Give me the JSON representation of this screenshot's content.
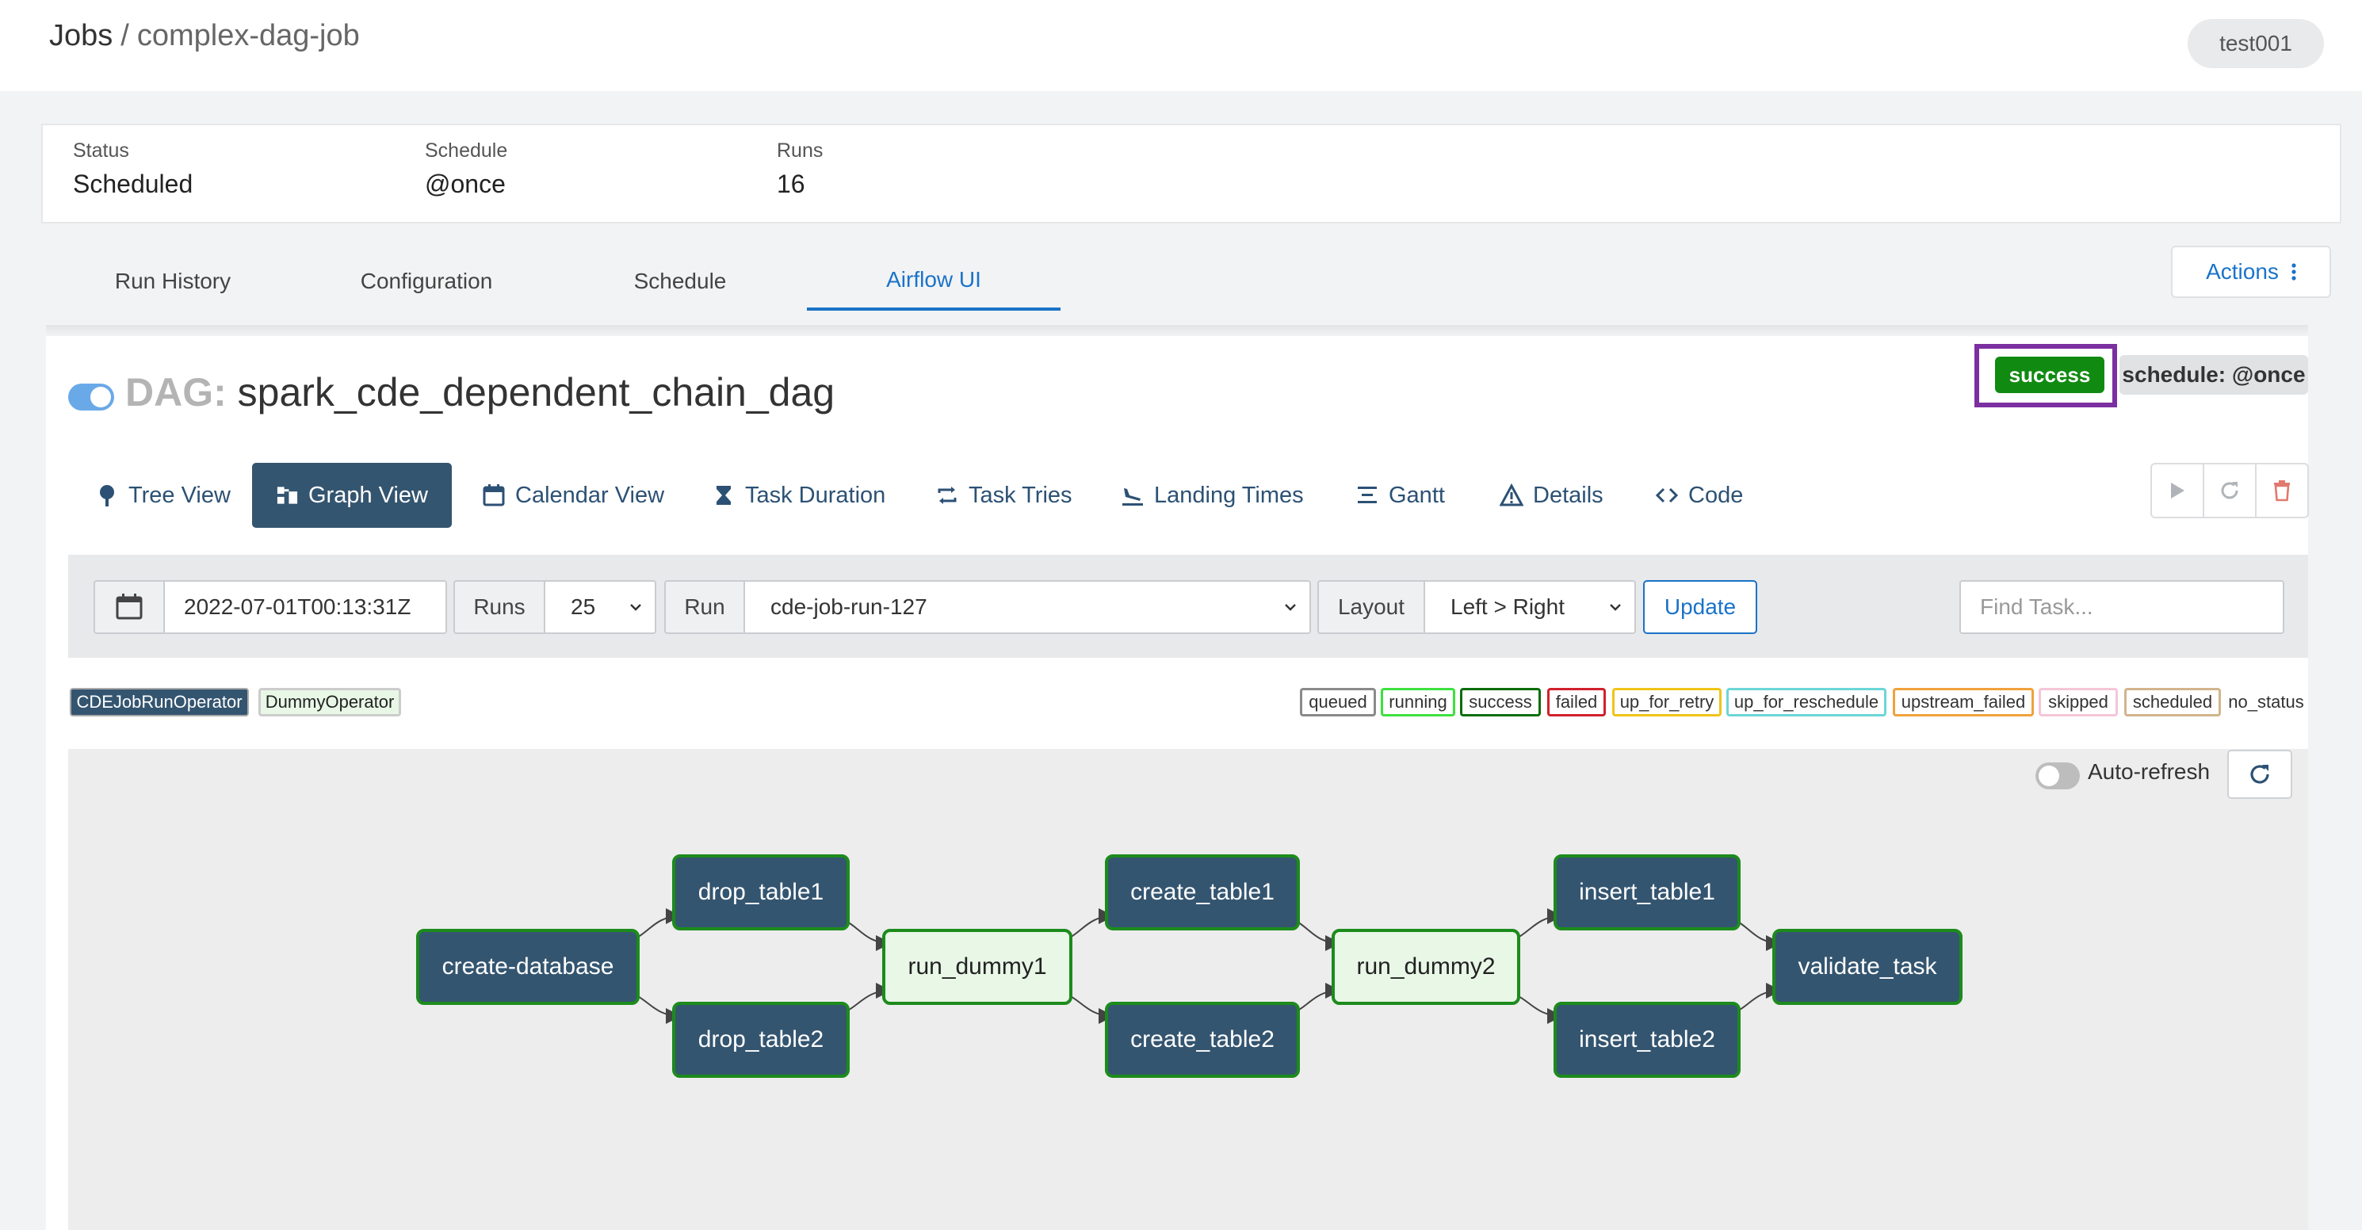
{
  "header": {
    "breadcrumb_root": "Jobs",
    "breadcrumb_sep": "/",
    "job_name": "complex-dag-job",
    "user": "test001"
  },
  "info": {
    "status_label": "Status",
    "status_value": "Scheduled",
    "schedule_label": "Schedule",
    "schedule_value": "@once",
    "runs_label": "Runs",
    "runs_value": "16"
  },
  "tabs": [
    "Run History",
    "Configuration",
    "Schedule",
    "Airflow UI"
  ],
  "active_tab": "Airflow UI",
  "actions_label": "Actions",
  "dag": {
    "prefix": "DAG:",
    "name": "spark_cde_dependent_chain_dag",
    "status": "success",
    "schedule": "schedule: @once"
  },
  "views": [
    "Tree View",
    "Graph View",
    "Calendar View",
    "Task Duration",
    "Task Tries",
    "Landing Times",
    "Gantt",
    "Details",
    "Code"
  ],
  "active_view": "Graph View",
  "filters": {
    "date": "2022-07-01T00:13:31Z",
    "runs_label": "Runs",
    "runs_value": "25",
    "run_label": "Run",
    "run_value": "cde-job-run-127",
    "layout_label": "Layout",
    "layout_value": "Left > Right",
    "update_label": "Update",
    "find_placeholder": "Find Task..."
  },
  "operators": [
    "CDEJobRunOperator",
    "DummyOperator"
  ],
  "states": [
    "queued",
    "running",
    "success",
    "failed",
    "up_for_retry",
    "up_for_reschedule",
    "upstream_failed",
    "skipped",
    "scheduled",
    "no_status"
  ],
  "colors": {
    "accent": "#1a73c8",
    "cde_node": "#345570",
    "dummy_node": "#e8f7e6",
    "success": "#118a11",
    "highlight": "#7b2fa0"
  },
  "graph": {
    "auto_refresh_label": "Auto-refresh",
    "auto_refresh_on": false,
    "nodes": [
      {
        "id": "create-database",
        "op": "cde"
      },
      {
        "id": "drop_table1",
        "op": "cde"
      },
      {
        "id": "drop_table2",
        "op": "cde"
      },
      {
        "id": "run_dummy1",
        "op": "dummy"
      },
      {
        "id": "create_table1",
        "op": "cde"
      },
      {
        "id": "create_table2",
        "op": "cde"
      },
      {
        "id": "run_dummy2",
        "op": "dummy"
      },
      {
        "id": "insert_table1",
        "op": "cde"
      },
      {
        "id": "insert_table2",
        "op": "cde"
      },
      {
        "id": "validate_task",
        "op": "cde"
      }
    ],
    "edges": [
      [
        "create-database",
        "drop_table1"
      ],
      [
        "create-database",
        "drop_table2"
      ],
      [
        "drop_table1",
        "run_dummy1"
      ],
      [
        "drop_table2",
        "run_dummy1"
      ],
      [
        "run_dummy1",
        "create_table1"
      ],
      [
        "run_dummy1",
        "create_table2"
      ],
      [
        "create_table1",
        "run_dummy2"
      ],
      [
        "create_table2",
        "run_dummy2"
      ],
      [
        "run_dummy2",
        "insert_table1"
      ],
      [
        "run_dummy2",
        "insert_table2"
      ],
      [
        "insert_table1",
        "validate_task"
      ],
      [
        "insert_table2",
        "validate_task"
      ]
    ]
  }
}
